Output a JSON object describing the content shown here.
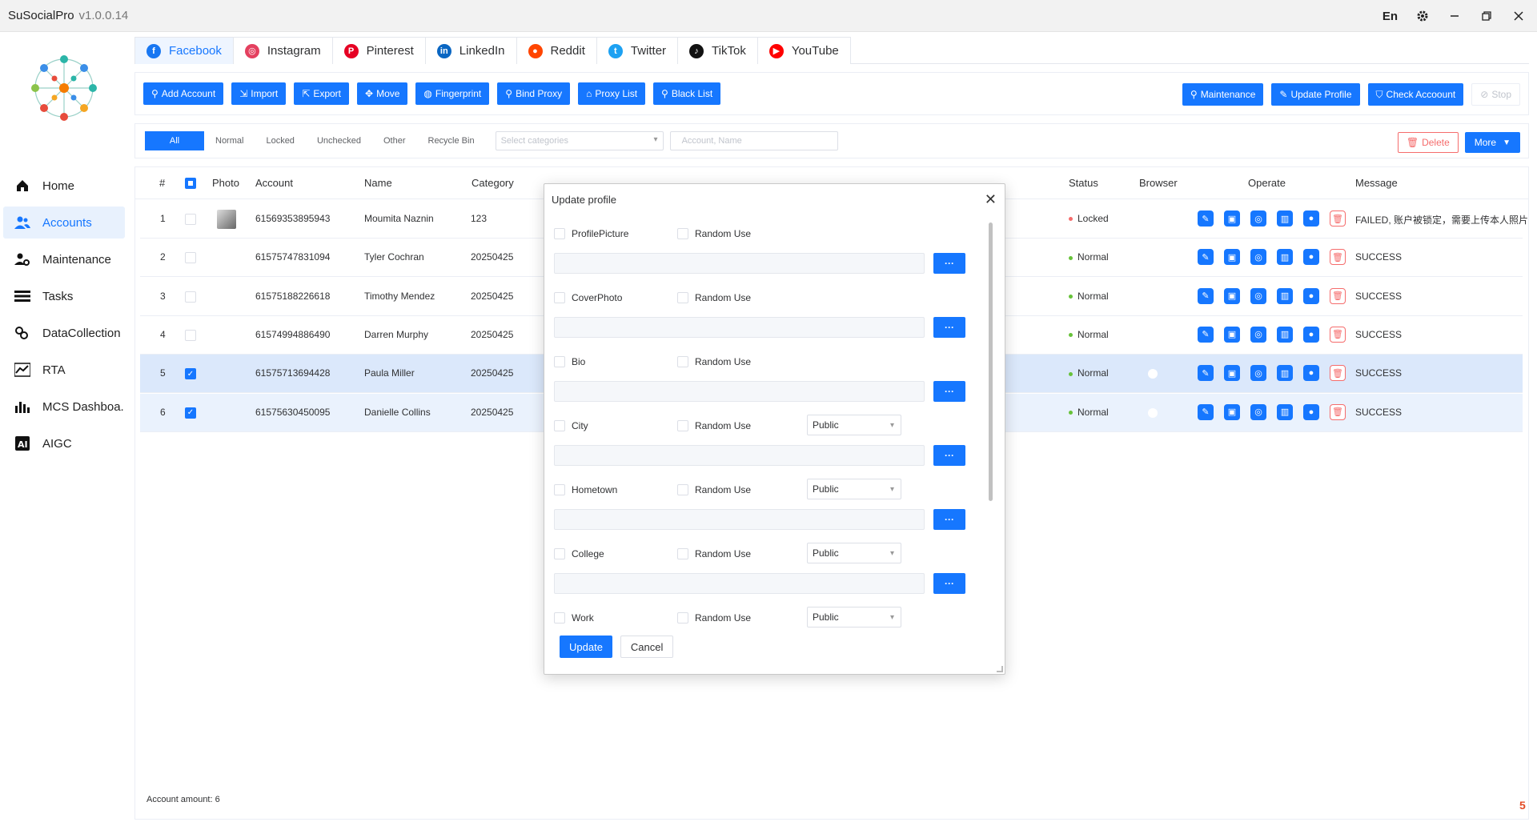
{
  "app": {
    "title": "SuSocialPro",
    "version": "v1.0.0.14",
    "lang": "En"
  },
  "sidebar": {
    "items": [
      {
        "label": "Home",
        "icon": "home-icon"
      },
      {
        "label": "Accounts",
        "icon": "users-icon",
        "active": true
      },
      {
        "label": "Maintenance",
        "icon": "user-gear-icon"
      },
      {
        "label": "Tasks",
        "icon": "list-icon"
      },
      {
        "label": "DataCollection",
        "icon": "link-icon"
      },
      {
        "label": "RTA",
        "icon": "line-chart-icon"
      },
      {
        "label": "MCS Dashboa...",
        "icon": "bar-chart-icon"
      },
      {
        "label": "AIGC",
        "icon": "ai-icon"
      }
    ]
  },
  "platforms": [
    {
      "label": "Facebook",
      "color": "#1877f2",
      "glyph": "f"
    },
    {
      "label": "Instagram",
      "color": "#e4405f",
      "glyph": "◎"
    },
    {
      "label": "Pinterest",
      "color": "#e60023",
      "glyph": "P"
    },
    {
      "label": "LinkedIn",
      "color": "#0a66c2",
      "glyph": "in"
    },
    {
      "label": "Reddit",
      "color": "#ff4500",
      "glyph": "●"
    },
    {
      "label": "Twitter",
      "color": "#1da1f2",
      "glyph": "t"
    },
    {
      "label": "TikTok",
      "color": "#111111",
      "glyph": "♪"
    },
    {
      "label": "YouTube",
      "color": "#ff0000",
      "glyph": "▶"
    }
  ],
  "toolbar": {
    "left": [
      "Add Account",
      "Import",
      "Export",
      "Move",
      "Fingerprint",
      "Bind Proxy",
      "Proxy List",
      "Black List"
    ],
    "right": [
      "Maintenance",
      "Update Profile",
      "Check Accoount"
    ],
    "stop": "Stop"
  },
  "filters": {
    "segments": [
      "All",
      "Normal",
      "Locked",
      "Unchecked",
      "Other",
      "Recycle Bin"
    ],
    "category_placeholder": "Select categories",
    "search_placeholder": "Account, Name",
    "delete": "Delete",
    "more": "More"
  },
  "table": {
    "headers": {
      "num": "#",
      "photo": "Photo",
      "account": "Account",
      "name": "Name",
      "category": "Category",
      "status": "Status",
      "browser": "Browser",
      "operate": "Operate",
      "message": "Message"
    },
    "rows": [
      {
        "num": "1",
        "account": "61569353895943",
        "name": "Moumita Naznin",
        "category": "123",
        "status": "Locked",
        "message": "FAILED, 账户被锁定，需要上传本人照片",
        "checked": false,
        "photo": true
      },
      {
        "num": "2",
        "account": "61575747831094",
        "name": "Tyler Cochran",
        "category": "20250425",
        "status": "Normal",
        "message": "SUCCESS",
        "checked": false
      },
      {
        "num": "3",
        "account": "61575188226618",
        "name": "Timothy Mendez",
        "category": "20250425",
        "status": "Normal",
        "message": "SUCCESS",
        "checked": false
      },
      {
        "num": "4",
        "account": "61574994886490",
        "name": "Darren Murphy",
        "category": "20250425",
        "status": "Normal",
        "message": "SUCCESS",
        "checked": false
      },
      {
        "num": "5",
        "account": "61575713694428",
        "name": "Paula Miller",
        "category": "20250425",
        "status": "Normal",
        "message": "SUCCESS",
        "checked": true
      },
      {
        "num": "6",
        "account": "61575630450095",
        "name": "Danielle Collins",
        "category": "20250425",
        "status": "Normal",
        "message": "SUCCESS",
        "checked": true
      }
    ],
    "status_colors": {
      "Locked": "#f56c6c",
      "Normal": "#67c23a"
    },
    "footer": "Account amount: 6"
  },
  "modal": {
    "title": "Update profile",
    "random_label": "Random Use",
    "fields": [
      {
        "label": "ProfilePicture",
        "privacy": null
      },
      {
        "label": "CoverPhoto",
        "privacy": null
      },
      {
        "label": "Bio",
        "privacy": null
      },
      {
        "label": "City",
        "privacy": "Public"
      },
      {
        "label": "Hometown",
        "privacy": "Public"
      },
      {
        "label": "College",
        "privacy": "Public"
      },
      {
        "label": "Work",
        "privacy": "Public"
      }
    ],
    "more_button": "···",
    "update": "Update",
    "cancel": "Cancel"
  },
  "colors": {
    "accent": "#1677ff",
    "danger": "#f56c6c",
    "success": "#67c23a"
  }
}
